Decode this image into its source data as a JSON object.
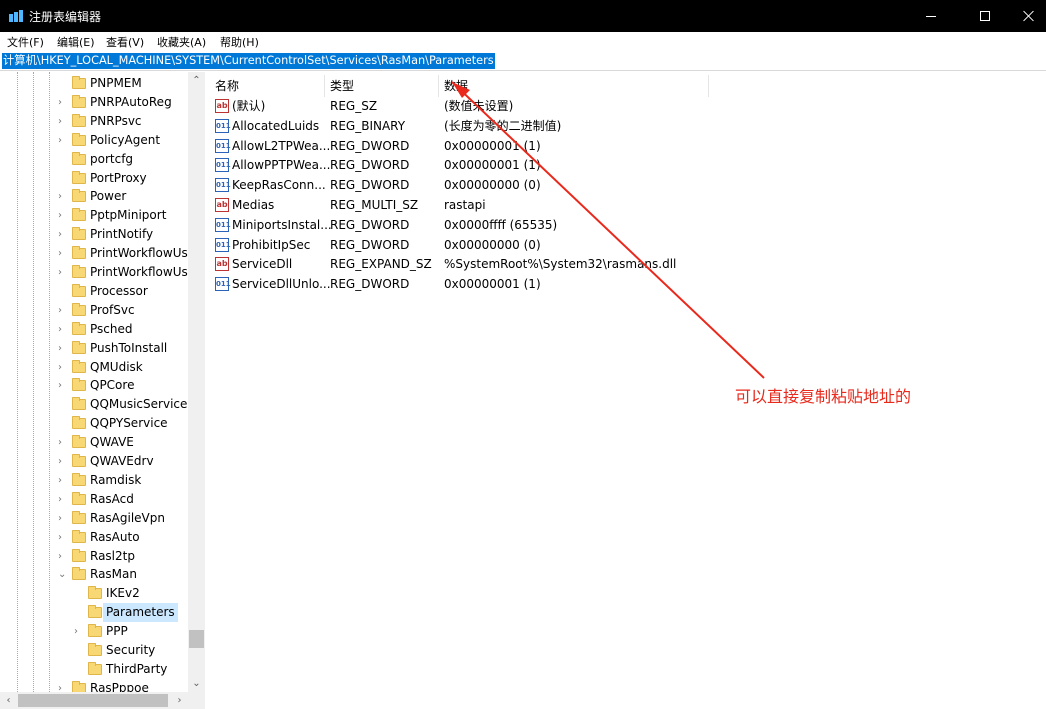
{
  "window": {
    "title": "注册表编辑器",
    "accent": "#0078d7"
  },
  "menu": [
    "文件(F)",
    "编辑(E)",
    "查看(V)",
    "收藏夹(A)",
    "帮助(H)"
  ],
  "address": "计算机\\HKEY_LOCAL_MACHINE\\SYSTEM\\CurrentControlSet\\Services\\RasMan\\Parameters",
  "tree": [
    {
      "label": "PNPMEM",
      "expandable": false
    },
    {
      "label": "PNRPAutoReg",
      "expandable": true
    },
    {
      "label": "PNRPsvc",
      "expandable": true
    },
    {
      "label": "PolicyAgent",
      "expandable": true
    },
    {
      "label": "portcfg",
      "expandable": false
    },
    {
      "label": "PortProxy",
      "expandable": false
    },
    {
      "label": "Power",
      "expandable": true
    },
    {
      "label": "PptpMiniport",
      "expandable": true
    },
    {
      "label": "PrintNotify",
      "expandable": true
    },
    {
      "label": "PrintWorkflowUse",
      "expandable": true
    },
    {
      "label": "PrintWorkflowUse",
      "expandable": true
    },
    {
      "label": "Processor",
      "expandable": false
    },
    {
      "label": "ProfSvc",
      "expandable": true
    },
    {
      "label": "Psched",
      "expandable": true
    },
    {
      "label": "PushToInstall",
      "expandable": true
    },
    {
      "label": "QMUdisk",
      "expandable": true
    },
    {
      "label": "QPCore",
      "expandable": true
    },
    {
      "label": "QQMusicService",
      "expandable": false
    },
    {
      "label": "QQPYService",
      "expandable": false
    },
    {
      "label": "QWAVE",
      "expandable": true
    },
    {
      "label": "QWAVEdrv",
      "expandable": true
    },
    {
      "label": "Ramdisk",
      "expandable": true
    },
    {
      "label": "RasAcd",
      "expandable": true
    },
    {
      "label": "RasAgileVpn",
      "expandable": true
    },
    {
      "label": "RasAuto",
      "expandable": true
    },
    {
      "label": "Rasl2tp",
      "expandable": true
    },
    {
      "label": "RasMan",
      "expandable": true,
      "expanded": true
    },
    {
      "label": "IKEv2",
      "child": true,
      "expandable": false
    },
    {
      "label": "Parameters",
      "child": true,
      "expandable": false,
      "selected": true
    },
    {
      "label": "PPP",
      "child": true,
      "expandable": true
    },
    {
      "label": "Security",
      "child": true,
      "expandable": false
    },
    {
      "label": "ThirdParty",
      "child": true,
      "expandable": false
    },
    {
      "label": "RasPppoe",
      "expandable": true
    }
  ],
  "columns": [
    "名称",
    "类型",
    "数据"
  ],
  "values": [
    {
      "icon": "ab",
      "name": "(默认)",
      "type": "REG_SZ",
      "data": "(数值未设置)"
    },
    {
      "icon": "bin",
      "name": "AllocatedLuids",
      "type": "REG_BINARY",
      "data": "(长度为零的二进制值)"
    },
    {
      "icon": "bin",
      "name": "AllowL2TPWea...",
      "type": "REG_DWORD",
      "data": "0x00000001 (1)"
    },
    {
      "icon": "bin",
      "name": "AllowPPTPWea...",
      "type": "REG_DWORD",
      "data": "0x00000001 (1)"
    },
    {
      "icon": "bin",
      "name": "KeepRasConn...",
      "type": "REG_DWORD",
      "data": "0x00000000 (0)"
    },
    {
      "icon": "ab",
      "name": "Medias",
      "type": "REG_MULTI_SZ",
      "data": "rastapi"
    },
    {
      "icon": "bin",
      "name": "MiniportsInstal...",
      "type": "REG_DWORD",
      "data": "0x0000ffff (65535)"
    },
    {
      "icon": "bin",
      "name": "ProhibitIpSec",
      "type": "REG_DWORD",
      "data": "0x00000000 (0)"
    },
    {
      "icon": "ab",
      "name": "ServiceDll",
      "type": "REG_EXPAND_SZ",
      "data": "%SystemRoot%\\System32\\rasmans.dll"
    },
    {
      "icon": "bin",
      "name": "ServiceDllUnlo...",
      "type": "REG_DWORD",
      "data": "0x00000001 (1)"
    }
  ],
  "annotation": {
    "text": "可以直接复制粘贴地址的",
    "color": "#e8291c"
  }
}
